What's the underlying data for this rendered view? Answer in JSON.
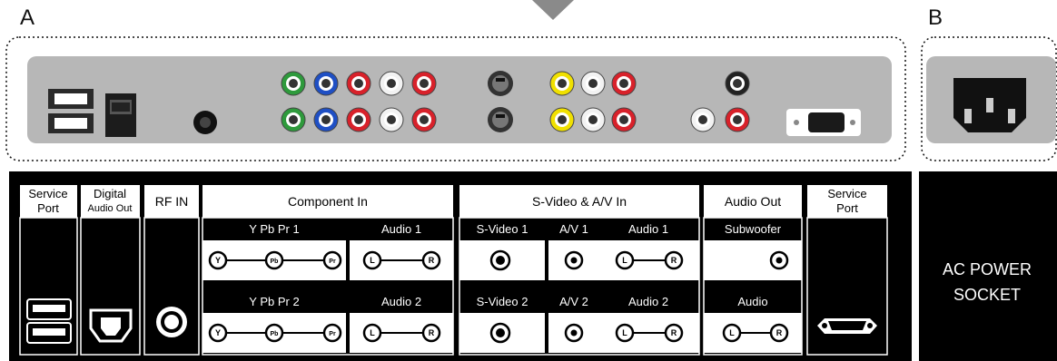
{
  "labels": {
    "panel_a": "A",
    "panel_b": "B"
  },
  "table": {
    "service_port": [
      "Service",
      "Port"
    ],
    "digital_audio_out": [
      "Digital",
      "Audio Out"
    ],
    "rf_in": "RF IN",
    "component_in": "Component  In",
    "ypbpr1": "Y Pb Pr   1",
    "audio1": "Audio 1",
    "ypbpr2": "Y Pb Pr   2",
    "audio2": "Audio 2",
    "svideo_av_in": "S-Video & A/V In",
    "svideo1": "S-Video 1",
    "av1": "A/V 1",
    "av_audio1": "Audio 1",
    "svideo2": "S-Video 2",
    "av2": "A/V 2",
    "av_audio2": "Audio 2",
    "audio_out": "Audio Out",
    "subwoofer": "Subwoofer",
    "audio": "Audio",
    "service_port_right": [
      "Service",
      "Port"
    ],
    "jack_letters": {
      "y": "Y",
      "pb": "Pb",
      "pr": "Pr",
      "l": "L",
      "r": "R"
    }
  },
  "ac_power": [
    "AC POWER",
    "SOCKET"
  ],
  "colors": {
    "green": "#2e9a3c",
    "blue": "#1f4fc4",
    "red": "#d8212a",
    "white": "#f2f2f2",
    "yellow": "#f0e000",
    "panel_gray": "#b7b7b7",
    "black": "#000000"
  }
}
